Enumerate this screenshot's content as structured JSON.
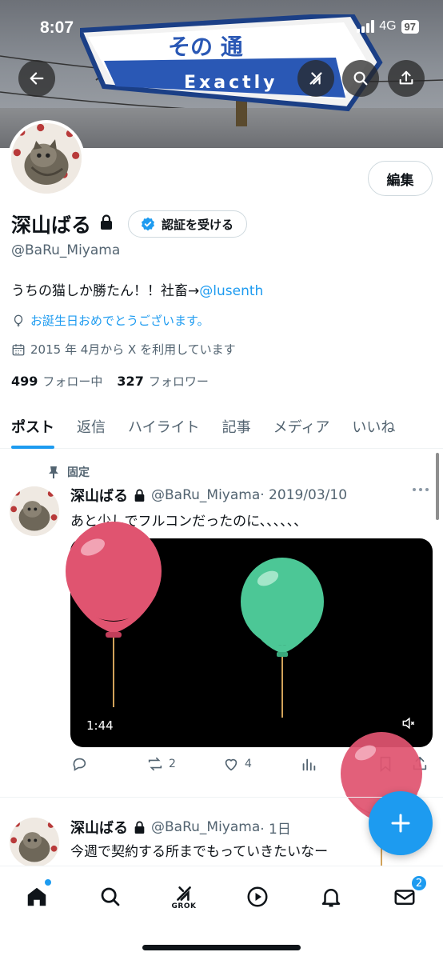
{
  "status_bar": {
    "time": "8:07",
    "network": "4G",
    "battery": "97"
  },
  "banner": {
    "sign_top_text": "その 通",
    "sign_bottom_text": "Exactly"
  },
  "profile": {
    "edit_label": "編集",
    "display_name": "深山ばる",
    "verify_label": "認証を受ける",
    "handle": "@BaRu_Miyama",
    "bio_text": "うちの猫しか勝たん！！社畜→",
    "bio_link": "@lusenth",
    "birthday": "お誕生日おめでとうございます。",
    "joined": "2015 年 4月から X を利用しています",
    "following_count": "499",
    "following_label": "フォロー中",
    "followers_count": "327",
    "followers_label": "フォロワー"
  },
  "tabs": [
    {
      "label": "ポスト"
    },
    {
      "label": "返信"
    },
    {
      "label": "ハイライト"
    },
    {
      "label": "記事"
    },
    {
      "label": "メディア"
    },
    {
      "label": "いいね"
    }
  ],
  "posts": [
    {
      "pinned_label": "固定",
      "name": "深山ばる",
      "handle": "@BaRu_Miyama",
      "date": "· 2019/03/10",
      "text": "あと少しでフルコンだったのに、、、、、、",
      "video_duration": "1:44",
      "retweets": "2",
      "likes": "4"
    },
    {
      "name": "深山ばる",
      "handle": "@BaRu_Miyama",
      "date": "· 1日",
      "text": "今週で契約する所までもっていきたいなー"
    }
  ],
  "bottom_nav": {
    "grok_label": "GROK",
    "messages_badge": "2"
  },
  "icons": [
    "back-arrow-icon",
    "grok-icon",
    "search-icon",
    "share-icon",
    "lock-icon",
    "verified-icon",
    "balloon-icon",
    "calendar-icon",
    "pin-icon",
    "more-icon",
    "mute-icon",
    "reply-icon",
    "retweet-icon",
    "like-icon",
    "views-icon",
    "bookmark-icon",
    "plus-icon",
    "home-icon",
    "play-icon",
    "bell-icon",
    "mail-icon"
  ],
  "colors": {
    "accent": "#1d9bf0",
    "text_primary": "#0f1419",
    "text_secondary": "#536471"
  }
}
